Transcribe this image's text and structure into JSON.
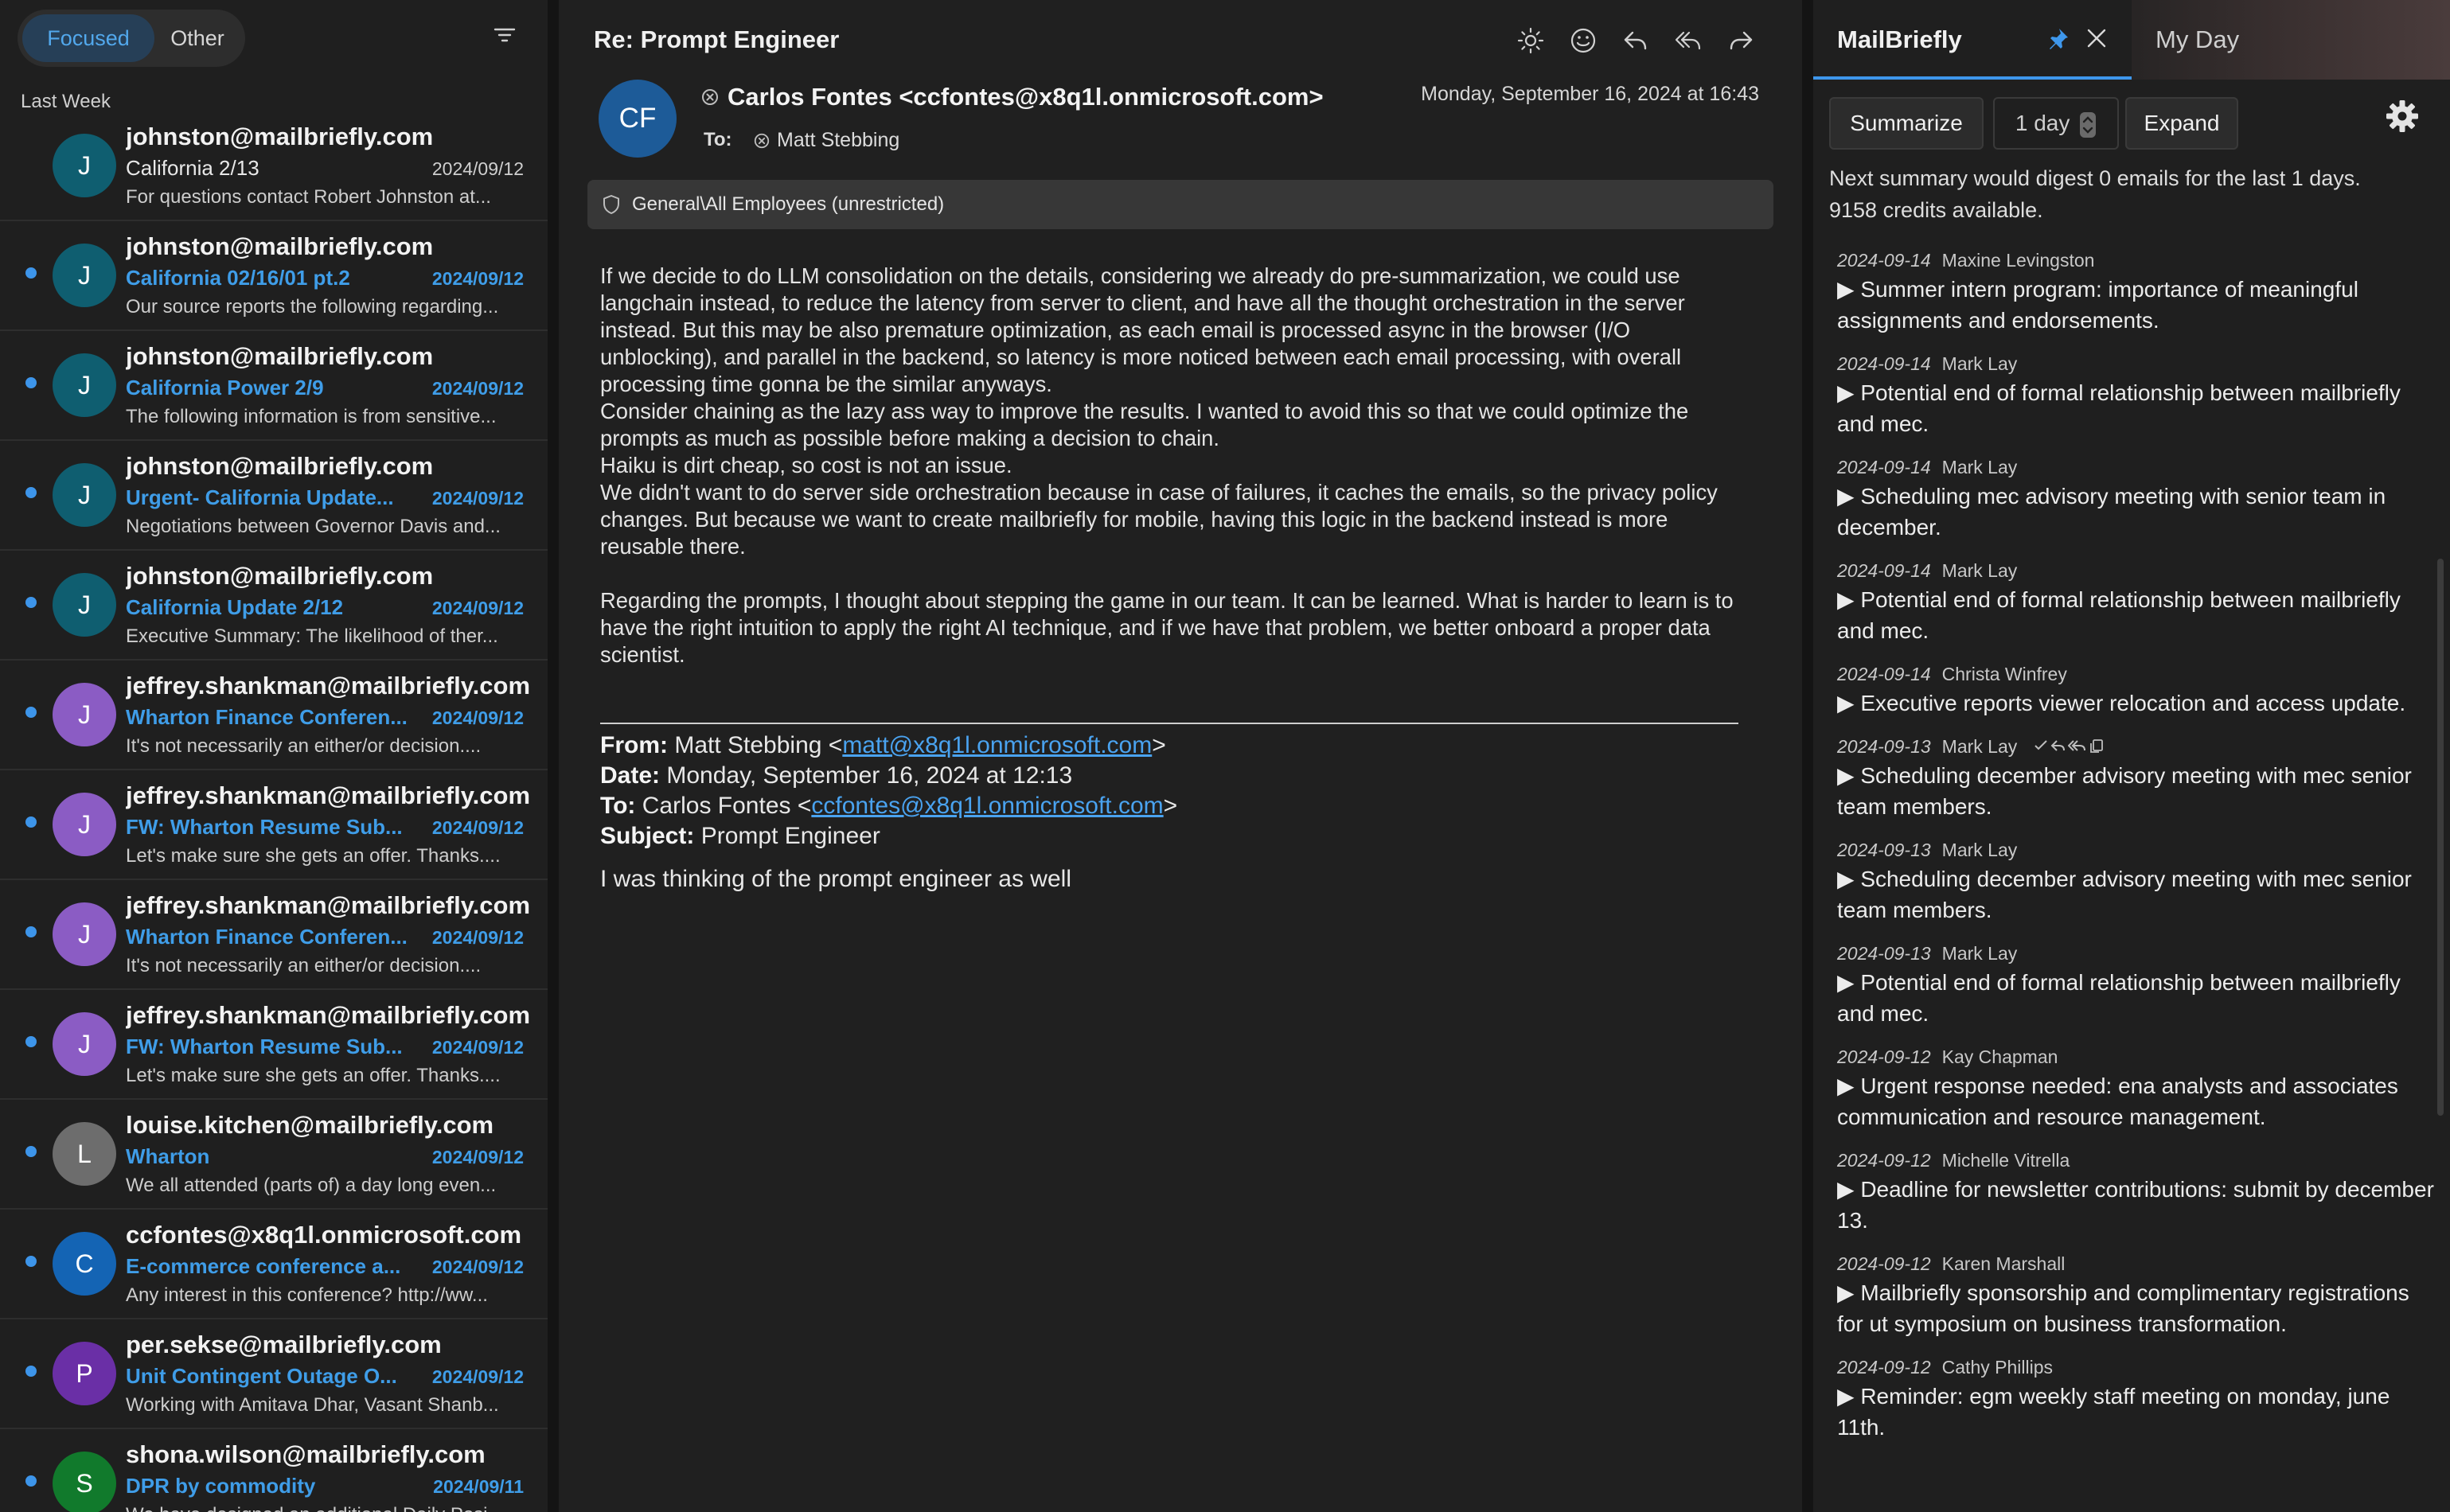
{
  "mail_list": {
    "tabs": {
      "focused": "Focused",
      "other": "Other"
    },
    "group_label": "Last Week",
    "items": [
      {
        "sender": "johnston@mailbriefly.com",
        "subject": "California 2/13",
        "date": "2024/09/12",
        "preview": "For questions contact Robert Johnston at...",
        "initial": "J",
        "unread": false,
        "avatar_color": "#0f5e70"
      },
      {
        "sender": "johnston@mailbriefly.com",
        "subject": "California 02/16/01 pt.2",
        "date": "2024/09/12",
        "preview": "Our source reports the following regarding...",
        "initial": "J",
        "unread": true,
        "avatar_color": "#0f5e70"
      },
      {
        "sender": "johnston@mailbriefly.com",
        "subject": "California Power 2/9",
        "date": "2024/09/12",
        "preview": "The following information is from sensitive...",
        "initial": "J",
        "unread": true,
        "avatar_color": "#0f5e70"
      },
      {
        "sender": "johnston@mailbriefly.com",
        "subject": "Urgent- California Update...",
        "date": "2024/09/12",
        "preview": "Negotiations between Governor Davis and...",
        "initial": "J",
        "unread": true,
        "avatar_color": "#0f5e70"
      },
      {
        "sender": "johnston@mailbriefly.com",
        "subject": "California Update 2/12",
        "date": "2024/09/12",
        "preview": "Executive Summary: The likelihood of ther...",
        "initial": "J",
        "unread": true,
        "avatar_color": "#0f5e70"
      },
      {
        "sender": "jeffrey.shankman@mailbriefly.com",
        "subject": "Wharton Finance Conferen...",
        "date": "2024/09/12",
        "preview": "It's not necessarily an either/or decision....",
        "initial": "J",
        "unread": true,
        "avatar_color": "#8b5cc4"
      },
      {
        "sender": "jeffrey.shankman@mailbriefly.com",
        "subject": "FW: Wharton Resume Sub...",
        "date": "2024/09/12",
        "preview": "Let's make sure she gets an offer. Thanks....",
        "initial": "J",
        "unread": true,
        "avatar_color": "#8b5cc4"
      },
      {
        "sender": "jeffrey.shankman@mailbriefly.com",
        "subject": "Wharton Finance Conferen...",
        "date": "2024/09/12",
        "preview": "It's not necessarily an either/or decision....",
        "initial": "J",
        "unread": true,
        "avatar_color": "#8b5cc4"
      },
      {
        "sender": "jeffrey.shankman@mailbriefly.com",
        "subject": "FW: Wharton Resume Sub...",
        "date": "2024/09/12",
        "preview": "Let's make sure she gets an offer. Thanks....",
        "initial": "J",
        "unread": true,
        "avatar_color": "#8b5cc4"
      },
      {
        "sender": "louise.kitchen@mailbriefly.com",
        "subject": "Wharton",
        "date": "2024/09/12",
        "preview": "We all attended (parts of) a day long even...",
        "initial": "L",
        "unread": true,
        "avatar_color": "#6d6d6d"
      },
      {
        "sender": "ccfontes@x8q1l.onmicrosoft.com",
        "subject": "E-commerce conference a...",
        "date": "2024/09/12",
        "preview": "Any interest in this conference? http://ww...",
        "initial": "C",
        "unread": true,
        "avatar_color": "#1464b4"
      },
      {
        "sender": "per.sekse@mailbriefly.com",
        "subject": "Unit Contingent Outage O...",
        "date": "2024/09/12",
        "preview": "Working with Amitava Dhar, Vasant Shanb...",
        "initial": "P",
        "unread": true,
        "avatar_color": "#6a2fa6"
      },
      {
        "sender": "shona.wilson@mailbriefly.com",
        "subject": "DPR by commodity",
        "date": "2024/09/11",
        "preview": "We have designed an additional Daily Posi...",
        "initial": "S",
        "unread": true,
        "avatar_color": "#117a2c"
      }
    ]
  },
  "reader": {
    "subject": "Re: Prompt Engineer",
    "avatar_initials": "CF",
    "from": "Carlos Fontes <ccfontes@x8q1l.onmicrosoft.com>",
    "to_label": "To:",
    "to": "Matt Stebbing",
    "date": "Monday, September 16, 2024 at 16:43",
    "sensitivity": "General\\All Employees (unrestricted)",
    "body": [
      "If we decide to do LLM consolidation on the details, considering we already do pre-summarization, we could use langchain instead, to reduce the latency from server to client, and have all the thought orchestration in the server instead. But this may be also premature optimization, as each email is processed async in the browser (I/O unblocking), and parallel in the backend, so latency is more noticed between each email processing, with overall processing time gonna be the similar anyways.",
      "Consider chaining as the lazy ass way to improve the results. I wanted to avoid this so that we could optimize the prompts as much as possible before making a decision to chain.",
      "Haiku is dirt cheap, so cost is not an issue.",
      "We didn't want to do server side orchestration because in case of failures, it caches the emails, so the privacy policy changes. But because we want to create mailbriefly for mobile, having this logic in the backend instead is more reusable there.",
      "Regarding the prompts, I thought about stepping the game in our team. It can be learned. What is harder to learn is to have the right intuition to apply the right AI technique, and if we have that problem, we better onboard a proper data scientist."
    ],
    "quoted": {
      "from_label": "From:",
      "from_name": "Matt Stebbing <",
      "from_email": "matt@x8q1l.onmicrosoft.com",
      "date_label": "Date:",
      "date": "Monday, September 16, 2024 at 12:13",
      "to_label": "To:",
      "to_name": "Carlos Fontes <",
      "to_email": "ccfontes@x8q1l.onmicrosoft.com",
      "close": ">",
      "subject_label": "Subject:",
      "subject": "Prompt Engineer",
      "body": "I was thinking of the prompt engineer as well"
    }
  },
  "brief": {
    "tab_title": "MailBriefly",
    "tab_other": "My Day",
    "summarize": "Summarize",
    "days": "1 day",
    "expand": "Expand",
    "info_line1": "Next summary would digest 0 emails for the last 1 days.",
    "info_line2": "9158 credits available.",
    "items": [
      {
        "date": "2024-09-14",
        "name": "Maxine Levingston",
        "text": "▶ Summer intern program: importance of meaningful assignments and endorsements."
      },
      {
        "date": "2024-09-14",
        "name": "Mark Lay",
        "text": "▶ Potential end of formal relationship between mailbriefly and mec."
      },
      {
        "date": "2024-09-14",
        "name": "Mark Lay",
        "text": "▶ Scheduling mec advisory meeting with senior team in december."
      },
      {
        "date": "2024-09-14",
        "name": "Mark Lay",
        "text": "▶ Potential end of formal relationship between mailbriefly and mec."
      },
      {
        "date": "2024-09-14",
        "name": "Christa Winfrey",
        "text": "▶ Executive reports viewer relocation and access update."
      },
      {
        "date": "2024-09-13",
        "name": "Mark Lay",
        "text": "▶ Scheduling december advisory meeting with mec senior team members.",
        "actions": true
      },
      {
        "date": "2024-09-13",
        "name": "Mark Lay",
        "text": "▶ Scheduling december advisory meeting with mec senior team members."
      },
      {
        "date": "2024-09-13",
        "name": "Mark Lay",
        "text": "▶ Potential end of formal relationship between mailbriefly and mec."
      },
      {
        "date": "2024-09-12",
        "name": "Kay Chapman",
        "text": "▶ Urgent response needed: ena analysts and associates communication and resource management."
      },
      {
        "date": "2024-09-12",
        "name": "Michelle Vitrella",
        "text": "▶ Deadline for newsletter contributions: submit by december 13."
      },
      {
        "date": "2024-09-12",
        "name": "Karen Marshall",
        "text": "▶ Mailbriefly sponsorship and complimentary registrations for ut symposium on business transformation."
      },
      {
        "date": "2024-09-12",
        "name": "Cathy Phillips",
        "text": "▶ Reminder: egm weekly staff meeting on monday, june 11th."
      }
    ]
  },
  "colors": {
    "accent": "#3e97ec",
    "link": "#4aa3f0",
    "unread": "#3f9de8"
  }
}
